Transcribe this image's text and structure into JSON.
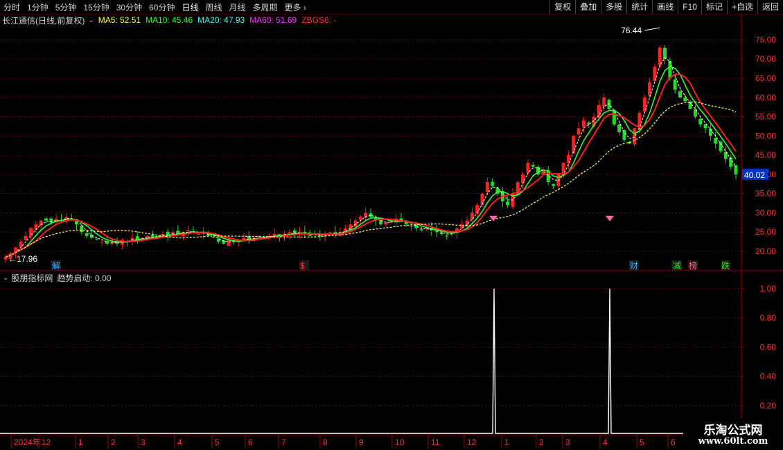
{
  "toolbar": {
    "periods": [
      {
        "label": "分时",
        "active": false
      },
      {
        "label": "1分钟",
        "active": false
      },
      {
        "label": "5分钟",
        "active": false
      },
      {
        "label": "15分钟",
        "active": false
      },
      {
        "label": "30分钟",
        "active": false
      },
      {
        "label": "60分钟",
        "active": false
      },
      {
        "label": "日线",
        "active": true
      },
      {
        "label": "周线",
        "active": false
      },
      {
        "label": "月线",
        "active": false
      },
      {
        "label": "多周期",
        "active": false
      },
      {
        "label": "更多",
        "active": false
      }
    ],
    "right_buttons": [
      "复权",
      "叠加",
      "多股",
      "统计",
      "画线",
      "F10",
      "标记",
      "+自选",
      "返回"
    ]
  },
  "header": {
    "title": "长江通信(日线,前复权)",
    "ma": [
      {
        "label": "MA5: 52.51",
        "color": "#ffff33"
      },
      {
        "label": "MA10: 45.46",
        "color": "#33ff33"
      },
      {
        "label": "MA20: 47.93",
        "color": "#33ffff"
      },
      {
        "label": "MA60: 51.69",
        "color": "#ff33ff"
      },
      {
        "label": "ZBGS6: -",
        "color": "#ff3333"
      }
    ]
  },
  "chart_data": {
    "type": "candlestick",
    "y_ticks": [
      20.0,
      25.0,
      30.0,
      35.0,
      40.0,
      45.0,
      50.0,
      55.0,
      60.0,
      65.0,
      70.0,
      75.0
    ],
    "ylim": [
      15.5,
      78.5
    ],
    "high_label": "76.44",
    "low_label": "17.96",
    "current_price": "40.02",
    "markers": [
      {
        "x_idx": 3,
        "text": "解"
      },
      {
        "x_idx": 0,
        "text": "$"
      },
      {
        "text": "财"
      },
      {
        "text": "减"
      },
      {
        "text": "榜"
      },
      {
        "text": "跌"
      }
    ],
    "closes": [
      18.5,
      19.5,
      21.0,
      22.5,
      24.0,
      26.0,
      27.0,
      28.0,
      28.0,
      27.5,
      28.5,
      28.0,
      29.0,
      28.5,
      27.0,
      25.0,
      24.0,
      23.5,
      23.0,
      22.5,
      22.0,
      22.5,
      22.0,
      23.0,
      22.5,
      23.5,
      23.0,
      23.5,
      24.0,
      23.5,
      24.0,
      24.5,
      24.0,
      25.0,
      24.5,
      25.0,
      25.5,
      25.0,
      24.5,
      25.0,
      24.0,
      23.5,
      22.5,
      22.0,
      23.0,
      22.5,
      23.0,
      23.5,
      23.0,
      23.5,
      24.0,
      23.5,
      24.0,
      24.5,
      24.0,
      24.5,
      25.0,
      24.5,
      25.0,
      24.5,
      24.0,
      24.5,
      24.0,
      24.5,
      25.0,
      24.5,
      25.0,
      26.0,
      27.0,
      28.0,
      29.0,
      30.0,
      29.0,
      28.0,
      27.0,
      27.5,
      28.0,
      28.5,
      28.0,
      27.0,
      26.5,
      26.0,
      25.5,
      26.0,
      25.5,
      25.0,
      24.5,
      24.0,
      25.0,
      26.0,
      27.0,
      28.0,
      30.0,
      32.0,
      35.0,
      38.0,
      37.0,
      35.0,
      33.0,
      32.0,
      35.0,
      38.0,
      40.0,
      43.0,
      42.0,
      40.0,
      41.0,
      38.0,
      37.0,
      40.0,
      43.0,
      45.0,
      50.0,
      52.0,
      54.0,
      53.0,
      55.0,
      58.0,
      60.0,
      57.0,
      53.0,
      51.0,
      49.0,
      48.0,
      52.0,
      56.0,
      60.0,
      64.0,
      68.0,
      73.0,
      70.0,
      65.0,
      62.0,
      60.0,
      59.0,
      57.0,
      55.0,
      53.0,
      52.0,
      50.0,
      48.0,
      46.0,
      44.0,
      42.0,
      40.02
    ],
    "x_labels": [
      "2024年",
      "12",
      "1",
      "2",
      "3",
      "4",
      "5",
      "6",
      "7",
      "8",
      "9",
      "10",
      "11",
      "12",
      "1",
      "2",
      "3",
      "4",
      "5",
      "6"
    ],
    "indicator": {
      "y_ticks": [
        0.2,
        0.4,
        0.6,
        0.8,
        1.0
      ],
      "ylim": [
        0,
        1.08
      ],
      "spikes_at_x_idx": [
        13,
        17
      ]
    }
  },
  "indicator_header": {
    "name": "股朋指标网",
    "value": "趋势启动: 0.00"
  },
  "watermark": {
    "line1": "乐淘公式网",
    "line2": "www.60lt.com"
  }
}
